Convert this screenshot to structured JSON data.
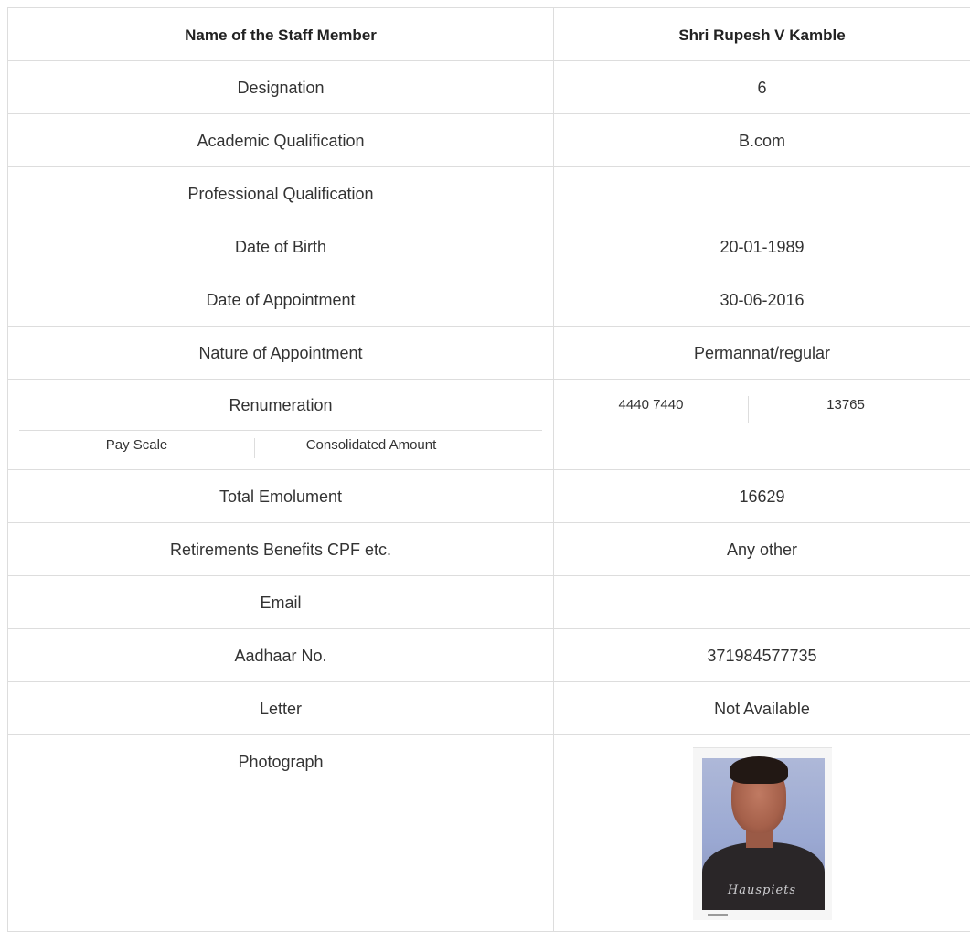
{
  "header": {
    "label": "Name of the Staff Member",
    "value": "Shri Rupesh V Kamble"
  },
  "rows": [
    {
      "label": "Designation",
      "value": "6"
    },
    {
      "label": "Academic Qualification",
      "value": "B.com"
    },
    {
      "label": "Professional Qualification",
      "value": ""
    },
    {
      "label": "Date of Birth",
      "value": "20-01-1989"
    },
    {
      "label": "Date of Appointment",
      "value": "30-06-2016"
    },
    {
      "label": "Nature of Appointment",
      "value": "Permannat/regular"
    }
  ],
  "renumeration": {
    "label": "Renumeration",
    "pay_scale_label": "Pay Scale",
    "consolidated_label": "Consolidated Amount",
    "pay_scale_value": "4440 7440",
    "consolidated_value": "13765"
  },
  "rows2": [
    {
      "label": "Total Emolument",
      "value": "16629"
    },
    {
      "label": "Retirements Benefits CPF etc.",
      "value": "Any other"
    },
    {
      "label": "Email",
      "value": ""
    },
    {
      "label": "Aadhaar No.",
      "value": "371984577735"
    },
    {
      "label": "Letter",
      "value": "Not Available"
    }
  ],
  "photo": {
    "label": "Photograph",
    "shirt_print": "Hauspiets"
  }
}
